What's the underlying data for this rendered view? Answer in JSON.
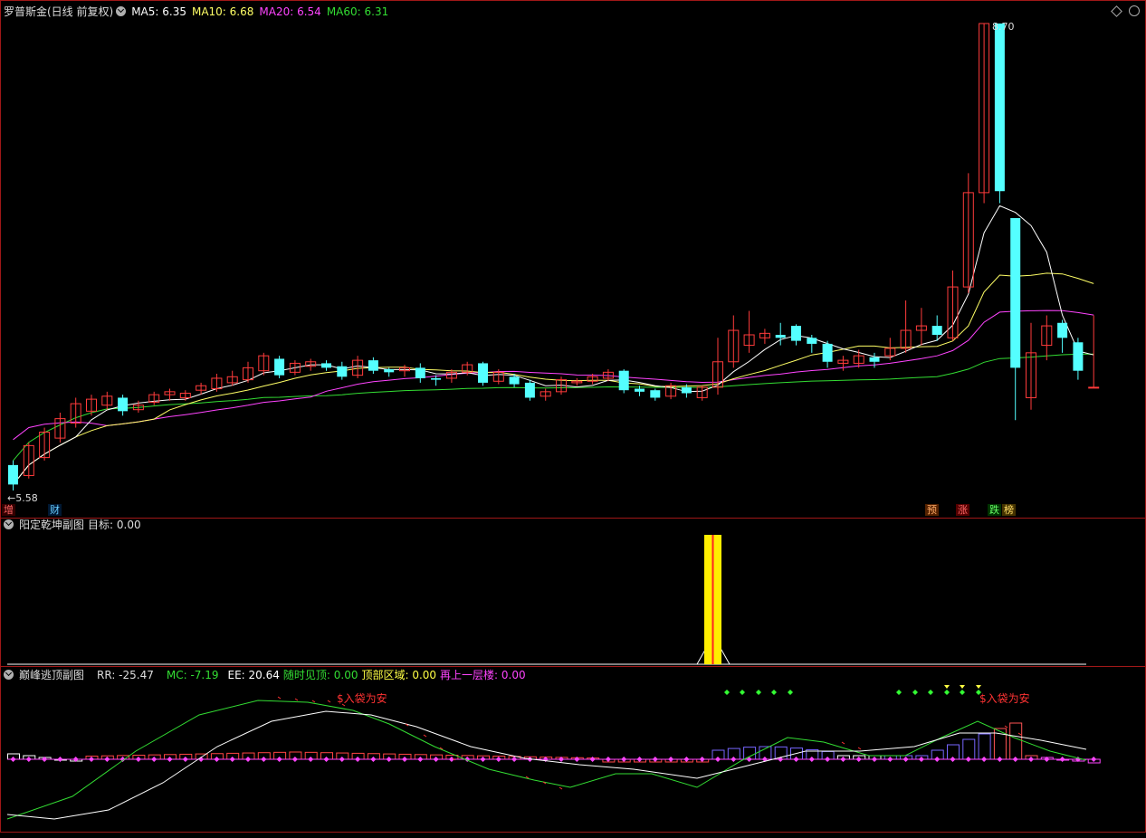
{
  "panel1": {
    "title": "罗普斯金(日线 前复权)",
    "ma": [
      {
        "label": "MA5: 6.35",
        "color": "#ffffff"
      },
      {
        "label": "MA10: 6.68",
        "color": "#ffff66"
      },
      {
        "label": "MA20: 6.54",
        "color": "#ff44ff"
      },
      {
        "label": "MA60: 6.31",
        "color": "#33dd33"
      }
    ],
    "high_label": "8.70",
    "low_label": "5.58",
    "bottom_tags": [
      {
        "text": "增",
        "color": "#ff6666",
        "bg": "#330000"
      },
      {
        "text": "财",
        "color": "#66ccff",
        "bg": "#001833"
      },
      {
        "text": "预",
        "color": "#ffaa66",
        "bg": "#552200"
      },
      {
        "text": "涨",
        "color": "#ff6666",
        "bg": "#550000"
      },
      {
        "text": "跌",
        "color": "#66ff66",
        "bg": "#003300"
      },
      {
        "text": "榜",
        "color": "#ffdd66",
        "bg": "#443300"
      }
    ]
  },
  "panel2": {
    "title": "阳定乾坤副图",
    "target_label": "目标: 0.00"
  },
  "panel3": {
    "title": "巅峰逃顶副图",
    "items": [
      {
        "label": "RR: -25.47",
        "color": "#dddddd"
      },
      {
        "label": "MC: -7.19",
        "color": "#33dd33"
      },
      {
        "label": "EE: 20.64",
        "color": "#ffffff"
      },
      {
        "label": "随时见顶: 0.00",
        "color": "#33dd33"
      },
      {
        "label": "顶部区域: 0.00",
        "color": "#ffff44"
      },
      {
        "label": "再上一层楼: 0.00",
        "color": "#ff44ff"
      }
    ],
    "annotation": "$入袋为安"
  },
  "chart_data": {
    "type": "candlestick",
    "price_range": [
      5.58,
      8.7
    ],
    "candles": [
      [
        5.75,
        5.62,
        5.78,
        5.58
      ],
      [
        5.68,
        5.88,
        5.9,
        5.66
      ],
      [
        5.8,
        5.97,
        6.0,
        5.78
      ],
      [
        5.93,
        6.06,
        6.1,
        5.9
      ],
      [
        6.03,
        6.16,
        6.2,
        6.0
      ],
      [
        6.11,
        6.19,
        6.22,
        6.08
      ],
      [
        6.15,
        6.21,
        6.24,
        6.12
      ],
      [
        6.2,
        6.11,
        6.22,
        6.08
      ],
      [
        6.12,
        6.15,
        6.18,
        6.1
      ],
      [
        6.17,
        6.22,
        6.24,
        6.15
      ],
      [
        6.22,
        6.24,
        6.26,
        6.18
      ],
      [
        6.2,
        6.23,
        6.25,
        6.18
      ],
      [
        6.25,
        6.28,
        6.3,
        6.22
      ],
      [
        6.26,
        6.33,
        6.36,
        6.24
      ],
      [
        6.3,
        6.34,
        6.38,
        6.28
      ],
      [
        6.32,
        6.4,
        6.44,
        6.3
      ],
      [
        6.38,
        6.48,
        6.5,
        6.35
      ],
      [
        6.46,
        6.35,
        6.48,
        6.33
      ],
      [
        6.37,
        6.43,
        6.45,
        6.35
      ],
      [
        6.41,
        6.44,
        6.46,
        6.38
      ],
      [
        6.43,
        6.4,
        6.45,
        6.38
      ],
      [
        6.41,
        6.34,
        6.44,
        6.32
      ],
      [
        6.35,
        6.45,
        6.48,
        6.33
      ],
      [
        6.45,
        6.38,
        6.47,
        6.36
      ],
      [
        6.39,
        6.37,
        6.4,
        6.34
      ],
      [
        6.38,
        6.4,
        6.42,
        6.34
      ],
      [
        6.4,
        6.33,
        6.43,
        6.3
      ],
      [
        6.33,
        6.32,
        6.35,
        6.28
      ],
      [
        6.33,
        6.37,
        6.39,
        6.3
      ],
      [
        6.37,
        6.42,
        6.44,
        6.35
      ],
      [
        6.43,
        6.3,
        6.44,
        6.28
      ],
      [
        6.31,
        6.37,
        6.39,
        6.29
      ],
      [
        6.34,
        6.29,
        6.36,
        6.27
      ],
      [
        6.3,
        6.2,
        6.32,
        6.18
      ],
      [
        6.21,
        6.24,
        6.26,
        6.18
      ],
      [
        6.24,
        6.32,
        6.34,
        6.22
      ],
      [
        6.3,
        6.31,
        6.33,
        6.28
      ],
      [
        6.31,
        6.34,
        6.36,
        6.29
      ],
      [
        6.33,
        6.37,
        6.39,
        6.31
      ],
      [
        6.38,
        6.25,
        6.39,
        6.23
      ],
      [
        6.26,
        6.24,
        6.28,
        6.21
      ],
      [
        6.25,
        6.2,
        6.26,
        6.18
      ],
      [
        6.21,
        6.28,
        6.3,
        6.19
      ],
      [
        6.27,
        6.23,
        6.29,
        6.2
      ],
      [
        6.2,
        6.27,
        6.28,
        6.18
      ],
      [
        6.27,
        6.44,
        6.6,
        6.22
      ],
      [
        6.44,
        6.65,
        6.75,
        6.4
      ],
      [
        6.55,
        6.62,
        6.78,
        6.5
      ],
      [
        6.6,
        6.63,
        6.66,
        6.56
      ],
      [
        6.62,
        6.6,
        6.7,
        6.55
      ],
      [
        6.68,
        6.58,
        6.69,
        6.55
      ],
      [
        6.6,
        6.56,
        6.62,
        6.5
      ],
      [
        6.56,
        6.44,
        6.58,
        6.4
      ],
      [
        6.43,
        6.45,
        6.48,
        6.38
      ],
      [
        6.43,
        6.48,
        6.52,
        6.4
      ],
      [
        6.47,
        6.44,
        6.5,
        6.4
      ],
      [
        6.48,
        6.53,
        6.6,
        6.45
      ],
      [
        6.53,
        6.65,
        6.85,
        6.5
      ],
      [
        6.65,
        6.68,
        6.8,
        6.55
      ],
      [
        6.68,
        6.62,
        6.75,
        6.58
      ],
      [
        6.6,
        6.94,
        7.05,
        6.58
      ],
      [
        6.94,
        7.57,
        7.7,
        6.9
      ],
      [
        7.57,
        8.7,
        8.7,
        7.5
      ],
      [
        8.7,
        7.58,
        8.7,
        7.5
      ],
      [
        7.4,
        6.4,
        7.4,
        6.05
      ],
      [
        6.2,
        6.5,
        6.7,
        6.12
      ],
      [
        6.55,
        6.68,
        6.75,
        6.45
      ],
      [
        6.7,
        6.6,
        6.72,
        6.5
      ],
      [
        6.57,
        6.38,
        6.6,
        6.32
      ],
      [
        6.27,
        6.27,
        6.75,
        6.27
      ]
    ]
  }
}
